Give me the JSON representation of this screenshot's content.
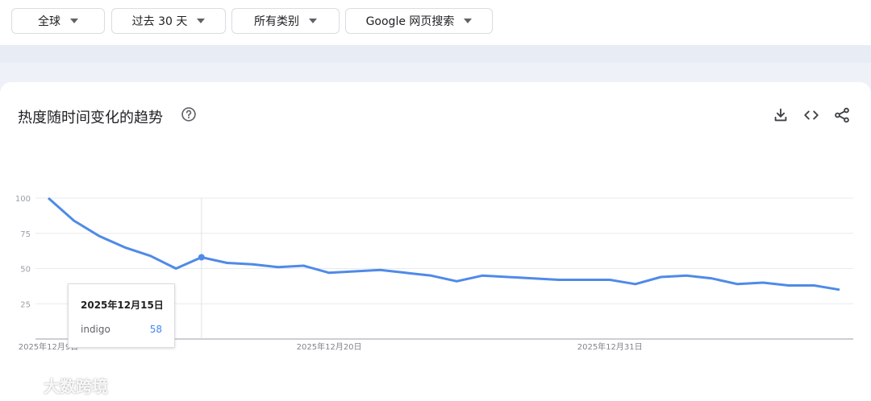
{
  "filters": {
    "region": "全球",
    "time": "过去 30 天",
    "category": "所有类别",
    "search_type": "Google 网页搜索"
  },
  "card": {
    "title": "热度随时间变化的趋势",
    "tools": [
      "download-icon",
      "embed-code-icon",
      "share-icon"
    ]
  },
  "tooltip": {
    "date": "2025年12月15日",
    "term": "indigo",
    "value": "58"
  },
  "watermark": "大数跨境",
  "colors": {
    "line": "#4f8ae8",
    "tooltip_value": "#4285f4"
  },
  "chart_data": {
    "type": "line",
    "title": "热度随时间变化的趋势",
    "xlabel": "",
    "ylabel": "",
    "ylim": [
      0,
      100
    ],
    "y_ticks": [
      "100",
      "75",
      "50",
      "25"
    ],
    "x_tick_labels": [
      "2025年12月9日",
      "2025年12月20日",
      "2025年12月31日"
    ],
    "x": [
      "2025-12-09",
      "2025-12-10",
      "2025-12-11",
      "2025-12-12",
      "2025-12-13",
      "2025-12-14",
      "2025-12-15",
      "2025-12-16",
      "2025-12-17",
      "2025-12-18",
      "2025-12-19",
      "2025-12-20",
      "2025-12-21",
      "2025-12-22",
      "2025-12-23",
      "2025-12-24",
      "2025-12-25",
      "2025-12-26",
      "2025-12-27",
      "2025-12-28",
      "2025-12-29",
      "2025-12-30",
      "2025-12-31",
      "2026-01-01",
      "2026-01-02",
      "2026-01-03",
      "2026-01-04",
      "2026-01-05",
      "2026-01-06",
      "2026-01-07",
      "2026-01-08"
    ],
    "series": [
      {
        "name": "indigo",
        "values": [
          100,
          84,
          73,
          65,
          59,
          50,
          58,
          54,
          53,
          51,
          52,
          47,
          48,
          49,
          47,
          45,
          41,
          45,
          44,
          43,
          42,
          42,
          42,
          39,
          44,
          45,
          43,
          39,
          40,
          38,
          38,
          35
        ]
      }
    ],
    "grid": true,
    "legend": "none"
  }
}
